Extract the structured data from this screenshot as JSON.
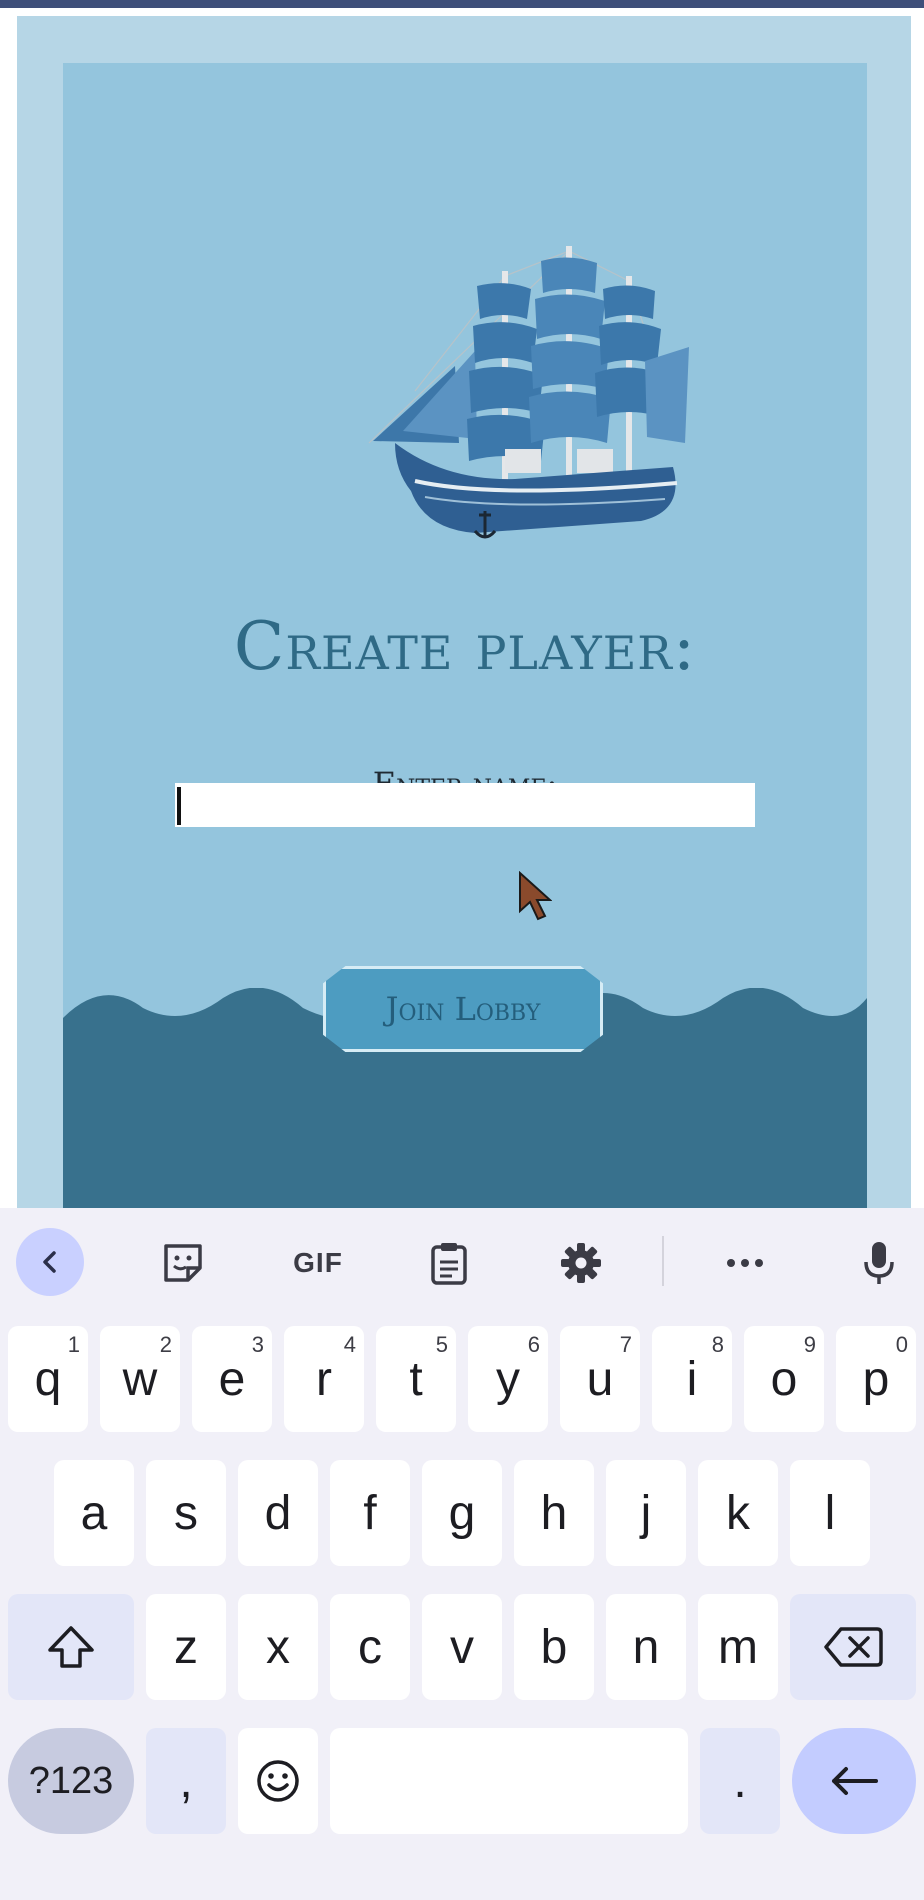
{
  "screen": {
    "title": "Create player:",
    "name_label": "Enter name:",
    "name_input": {
      "value": "",
      "placeholder": ""
    },
    "join_button": "Join Lobby"
  },
  "keyboard": {
    "toolbar": [
      "back-icon",
      "sticker-icon",
      "GIF",
      "clipboard-icon",
      "gear-icon",
      "more-icon",
      "microphone-icon"
    ],
    "gif_label": "GIF",
    "row1": [
      {
        "key": "q",
        "hint": "1"
      },
      {
        "key": "w",
        "hint": "2"
      },
      {
        "key": "e",
        "hint": "3"
      },
      {
        "key": "r",
        "hint": "4"
      },
      {
        "key": "t",
        "hint": "5"
      },
      {
        "key": "y",
        "hint": "6"
      },
      {
        "key": "u",
        "hint": "7"
      },
      {
        "key": "i",
        "hint": "8"
      },
      {
        "key": "o",
        "hint": "9"
      },
      {
        "key": "p",
        "hint": "0"
      }
    ],
    "row2": [
      "a",
      "s",
      "d",
      "f",
      "g",
      "h",
      "j",
      "k",
      "l"
    ],
    "row3": [
      "z",
      "x",
      "c",
      "v",
      "b",
      "n",
      "m"
    ],
    "row4": {
      "symbols": "?123",
      "comma": ",",
      "period": "."
    }
  },
  "colors": {
    "frame": "#b6d6e6",
    "panel": "#94c5dd",
    "sea": "#38718d",
    "button": "#4d9cc1",
    "title": "#2f6a86"
  }
}
